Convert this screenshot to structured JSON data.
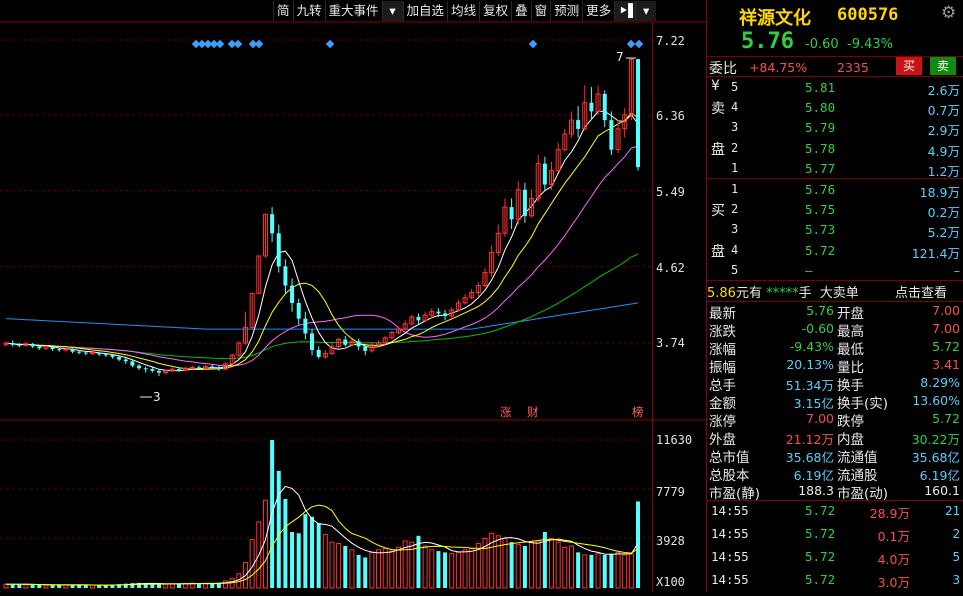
{
  "toolbar": {
    "items": [
      "简",
      "九转",
      "重大事件",
      "▾",
      "加自选",
      "均线",
      "复权",
      "叠",
      "窗",
      "预测",
      "更多",
      "⯈▌",
      "▾"
    ]
  },
  "stock": {
    "name": "祥源文化",
    "code": "600576",
    "price": "5.76",
    "change": "-0.60",
    "change_pct": "-9.43%",
    "gear_icon": "gear-icon"
  },
  "weibi": {
    "label": "委比",
    "pct": "+84.75%",
    "diff": "2335",
    "sell_btn": "买",
    "buy_btn": "卖"
  },
  "asks": [
    {
      "n": "5",
      "price": "5.81",
      "vol": "2.6万"
    },
    {
      "n": "4",
      "price": "5.80",
      "vol": "0.7万"
    },
    {
      "n": "3",
      "price": "5.79",
      "vol": "2.9万"
    },
    {
      "n": "2",
      "price": "5.78",
      "vol": "4.9万"
    },
    {
      "n": "1",
      "price": "5.77",
      "vol": "1.2万"
    }
  ],
  "ask_label": [
    "¥",
    "卖",
    "",
    "盘",
    ""
  ],
  "bids": [
    {
      "n": "1",
      "price": "5.76",
      "vol": "18.9万"
    },
    {
      "n": "2",
      "price": "5.75",
      "vol": "0.2万"
    },
    {
      "n": "3",
      "price": "5.73",
      "vol": "5.2万"
    },
    {
      "n": "4",
      "price": "5.72",
      "vol": "121.4万"
    },
    {
      "n": "5",
      "price": "–",
      "vol": "–"
    }
  ],
  "bid_label": [
    "",
    "买",
    "",
    "盘",
    ""
  ],
  "bigorder": {
    "price": "5.86",
    "unit": "元有",
    "stars": "*****",
    "hand": "手",
    "title": "大卖单",
    "link": "点击查看"
  },
  "stats": [
    {
      "l1": "最新",
      "v1": "5.76",
      "c1": "green",
      "l2": "开盘",
      "v2": "7.00",
      "c2": "red"
    },
    {
      "l1": "涨跌",
      "v1": "-0.60",
      "c1": "green",
      "l2": "最高",
      "v2": "7.00",
      "c2": "red"
    },
    {
      "l1": "涨幅",
      "v1": "-9.43%",
      "c1": "green",
      "l2": "最低",
      "v2": "5.72",
      "c2": "green"
    },
    {
      "l1": "振幅",
      "v1": "20.13%",
      "c1": "cyan",
      "l2": "量比",
      "v2": "3.41",
      "c2": "red"
    },
    {
      "l1": "总手",
      "v1": "51.34万",
      "c1": "cyan",
      "l2": "换手",
      "v2": "8.29%",
      "c2": "cyan"
    },
    {
      "l1": "金额",
      "v1": "3.15亿",
      "c1": "cyan",
      "l2": "换手(实)",
      "v2": "13.60%",
      "c2": "cyan"
    },
    {
      "l1": "涨停",
      "v1": "7.00",
      "c1": "red",
      "l2": "跌停",
      "v2": "5.72",
      "c2": "green"
    },
    {
      "l1": "外盘",
      "v1": "21.12万",
      "c1": "red",
      "l2": "内盘",
      "v2": "30.22万",
      "c2": "green"
    },
    {
      "l1": "总市值",
      "v1": "35.68亿",
      "c1": "cyan",
      "l2": "流通值",
      "v2": "35.68亿",
      "c2": "cyan"
    },
    {
      "l1": "总股本",
      "v1": "6.19亿",
      "c1": "cyan",
      "l2": "流通股",
      "v2": "6.19亿",
      "c2": "cyan"
    },
    {
      "l1": "市盈(静)",
      "v1": "188.3",
      "c1": "white",
      "l2": "市盈(动)",
      "v2": "160.1",
      "c2": "white"
    }
  ],
  "ticks": [
    {
      "time": "14:55",
      "price": "5.72",
      "vol": "28.9万",
      "n": "21"
    },
    {
      "time": "14:55",
      "price": "5.72",
      "vol": "0.1万",
      "n": "2"
    },
    {
      "time": "14:55",
      "price": "5.72",
      "vol": "4.0万",
      "n": "5"
    },
    {
      "time": "14:55",
      "price": "5.72",
      "vol": "3.0万",
      "n": "3"
    }
  ],
  "chart_data": {
    "type": "candlestick",
    "price_axis_labels": [
      "7.22",
      "6.36",
      "5.49",
      "4.62",
      "3.74"
    ],
    "price_axis_values": [
      7.22,
      6.36,
      5.49,
      4.62,
      3.74
    ],
    "volume_axis_labels": [
      "11630",
      "7779",
      "3928",
      "X100"
    ],
    "volume_axis_values": [
      11630,
      7779,
      3928
    ],
    "annotations": [
      "7",
      "3",
      "涨",
      "财",
      "榜"
    ],
    "colors": {
      "up": "#ff3232",
      "down": "#54ffff",
      "ma5": "#ffffff",
      "ma10": "#ffff00",
      "ma20": "#ff66ff",
      "ma60": "#00c000",
      "ma120": "#1e90ff"
    },
    "candles": [
      [
        3.72,
        3.74,
        3.7,
        3.76
      ],
      [
        3.74,
        3.72,
        3.7,
        3.77
      ],
      [
        3.72,
        3.71,
        3.69,
        3.74
      ],
      [
        3.71,
        3.73,
        3.7,
        3.75
      ],
      [
        3.73,
        3.7,
        3.68,
        3.74
      ],
      [
        3.7,
        3.68,
        3.66,
        3.72
      ],
      [
        3.68,
        3.7,
        3.66,
        3.71
      ],
      [
        3.7,
        3.67,
        3.65,
        3.71
      ],
      [
        3.67,
        3.66,
        3.64,
        3.69
      ],
      [
        3.66,
        3.67,
        3.64,
        3.68
      ],
      [
        3.67,
        3.64,
        3.62,
        3.68
      ],
      [
        3.64,
        3.63,
        3.61,
        3.66
      ],
      [
        3.63,
        3.62,
        3.6,
        3.65
      ],
      [
        3.62,
        3.63,
        3.6,
        3.64
      ],
      [
        3.63,
        3.61,
        3.59,
        3.64
      ],
      [
        3.61,
        3.6,
        3.58,
        3.62
      ],
      [
        3.6,
        3.58,
        3.56,
        3.61
      ],
      [
        3.58,
        3.55,
        3.53,
        3.59
      ],
      [
        3.55,
        3.53,
        3.5,
        3.57
      ],
      [
        3.53,
        3.48,
        3.46,
        3.55
      ],
      [
        3.48,
        3.45,
        3.43,
        3.5
      ],
      [
        3.45,
        3.44,
        3.4,
        3.47
      ],
      [
        3.44,
        3.42,
        3.4,
        3.46
      ],
      [
        3.42,
        3.4,
        3.36,
        3.44
      ],
      [
        3.4,
        3.42,
        3.38,
        3.43
      ],
      [
        3.42,
        3.44,
        3.41,
        3.46
      ],
      [
        3.44,
        3.43,
        3.41,
        3.46
      ],
      [
        3.43,
        3.45,
        3.42,
        3.47
      ],
      [
        3.45,
        3.46,
        3.44,
        3.48
      ],
      [
        3.46,
        3.45,
        3.43,
        3.48
      ],
      [
        3.45,
        3.47,
        3.44,
        3.49
      ],
      [
        3.47,
        3.46,
        3.44,
        3.49
      ],
      [
        3.46,
        3.44,
        3.42,
        3.48
      ],
      [
        3.44,
        3.5,
        3.43,
        3.52
      ],
      [
        3.5,
        3.6,
        3.49,
        3.62
      ],
      [
        3.6,
        3.74,
        3.58,
        3.76
      ],
      [
        3.74,
        3.92,
        3.72,
        4.1
      ],
      [
        3.92,
        4.31,
        3.9,
        4.31
      ],
      [
        4.31,
        4.74,
        4.3,
        4.74
      ],
      [
        4.74,
        5.22,
        4.72,
        5.22
      ],
      [
        5.22,
        5.0,
        4.9,
        5.3
      ],
      [
        5.0,
        4.62,
        4.55,
        5.1
      ],
      [
        4.62,
        4.4,
        4.3,
        4.7
      ],
      [
        4.4,
        4.2,
        4.1,
        4.48
      ],
      [
        4.2,
        4.02,
        3.95,
        4.25
      ],
      [
        4.02,
        3.85,
        3.78,
        4.1
      ],
      [
        3.85,
        3.66,
        3.6,
        3.9
      ],
      [
        3.66,
        3.58,
        3.56,
        3.7
      ],
      [
        3.58,
        3.62,
        3.56,
        3.66
      ],
      [
        3.62,
        3.7,
        3.6,
        3.74
      ],
      [
        3.7,
        3.78,
        3.68,
        3.8
      ],
      [
        3.78,
        3.72,
        3.7,
        3.82
      ],
      [
        3.72,
        3.76,
        3.7,
        3.78
      ],
      [
        3.76,
        3.7,
        3.66,
        3.79
      ],
      [
        3.7,
        3.65,
        3.6,
        3.72
      ],
      [
        3.65,
        3.72,
        3.63,
        3.74
      ],
      [
        3.72,
        3.74,
        3.7,
        3.77
      ],
      [
        3.74,
        3.8,
        3.72,
        3.82
      ],
      [
        3.8,
        3.86,
        3.78,
        3.88
      ],
      [
        3.86,
        3.9,
        3.84,
        3.93
      ],
      [
        3.9,
        3.96,
        3.88,
        4.0
      ],
      [
        3.96,
        4.04,
        3.94,
        4.06
      ],
      [
        4.04,
        4.0,
        3.96,
        4.08
      ],
      [
        4.0,
        4.06,
        3.98,
        4.1
      ],
      [
        4.06,
        4.1,
        4.02,
        4.14
      ],
      [
        4.1,
        4.08,
        4.04,
        4.14
      ],
      [
        4.08,
        4.05,
        4.0,
        4.12
      ],
      [
        4.05,
        4.12,
        4.02,
        4.15
      ],
      [
        4.12,
        4.2,
        4.1,
        4.24
      ],
      [
        4.2,
        4.26,
        4.18,
        4.3
      ],
      [
        4.26,
        4.32,
        4.24,
        4.36
      ],
      [
        4.32,
        4.4,
        4.28,
        4.44
      ],
      [
        4.4,
        4.55,
        4.38,
        4.6
      ],
      [
        4.55,
        4.78,
        4.5,
        4.86
      ],
      [
        4.78,
        5.0,
        4.74,
        5.1
      ],
      [
        5.0,
        5.3,
        4.96,
        5.4
      ],
      [
        5.3,
        5.16,
        5.05,
        5.4
      ],
      [
        5.16,
        5.5,
        5.1,
        5.6
      ],
      [
        5.5,
        5.2,
        5.12,
        5.58
      ],
      [
        5.2,
        5.4,
        5.18,
        5.5
      ],
      [
        5.4,
        5.8,
        5.36,
        5.9
      ],
      [
        5.8,
        5.56,
        5.48,
        5.88
      ],
      [
        5.56,
        5.72,
        5.5,
        5.82
      ],
      [
        5.72,
        5.96,
        5.7,
        6.04
      ],
      [
        5.96,
        6.14,
        5.94,
        6.2
      ],
      [
        6.14,
        6.3,
        6.1,
        6.4
      ],
      [
        6.3,
        6.2,
        6.1,
        6.46
      ],
      [
        6.2,
        6.5,
        6.18,
        6.7
      ],
      [
        6.5,
        6.4,
        6.3,
        6.68
      ],
      [
        6.4,
        6.6,
        6.36,
        6.7
      ],
      [
        6.6,
        6.3,
        6.22,
        6.64
      ],
      [
        6.3,
        5.96,
        5.9,
        6.4
      ],
      [
        5.96,
        6.2,
        5.92,
        6.3
      ],
      [
        6.2,
        6.36,
        6.1,
        6.44
      ],
      [
        6.36,
        7.0,
        6.3,
        7.0
      ],
      [
        7.0,
        5.76,
        5.72,
        7.0
      ]
    ],
    "volumes": [
      300,
      280,
      310,
      260,
      250,
      240,
      230,
      220,
      260,
      240,
      230,
      250,
      220,
      230,
      210,
      200,
      260,
      300,
      340,
      380,
      400,
      360,
      330,
      310,
      300,
      320,
      340,
      360,
      380,
      360,
      350,
      340,
      420,
      560,
      760,
      1120,
      2000,
      3800,
      5200,
      6900,
      11630,
      9200,
      7000,
      4400,
      4300,
      5800,
      5600,
      5100,
      4200,
      3600,
      3500,
      3300,
      3000,
      2600,
      2400,
      2800,
      3000,
      3100,
      2900,
      3200,
      3700,
      3600,
      4100,
      3300,
      3000,
      2900,
      2800,
      2700,
      2800,
      3000,
      3100,
      3500,
      3900,
      4300,
      4100,
      3900,
      3600,
      3400,
      3300,
      3600,
      3700,
      4400,
      3900,
      3600,
      3200,
      3300,
      2800,
      2600,
      2600,
      2700,
      2600,
      2700,
      2800,
      2600,
      2700,
      6800
    ]
  }
}
